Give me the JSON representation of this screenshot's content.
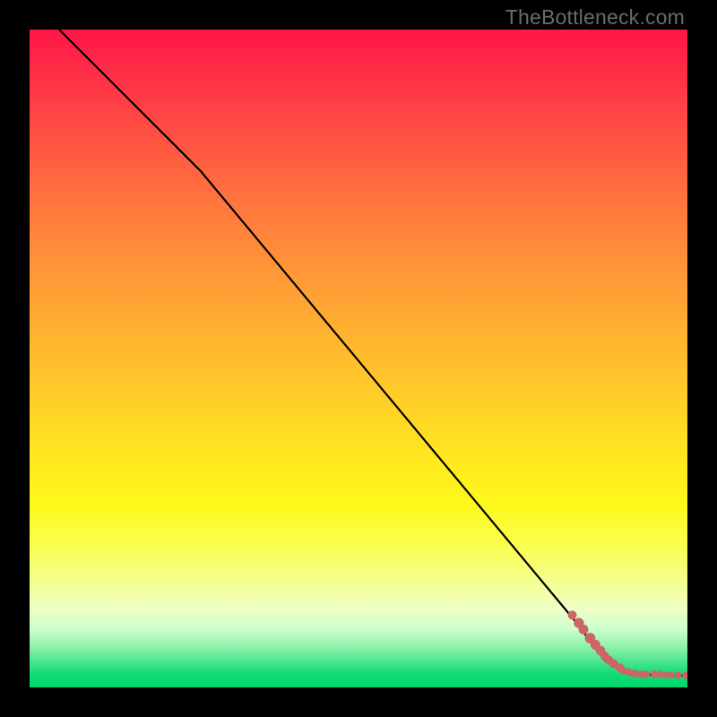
{
  "watermark": "TheBottleneck.com",
  "chart_data": {
    "type": "line",
    "title": "",
    "xlabel": "",
    "ylabel": "",
    "xlim": [
      0,
      100
    ],
    "ylim": [
      0,
      100
    ],
    "series": [
      {
        "name": "curve",
        "style": "line",
        "color": "#000000",
        "points": [
          {
            "x": 4.5,
            "y": 100.0
          },
          {
            "x": 26.0,
            "y": 78.5
          },
          {
            "x": 83.0,
            "y": 10.0
          },
          {
            "x": 87.5,
            "y": 4.0
          },
          {
            "x": 91.0,
            "y": 2.0
          },
          {
            "x": 100.0,
            "y": 1.8
          }
        ]
      },
      {
        "name": "dots",
        "style": "scatter",
        "color": "#cc6666",
        "points": [
          {
            "x": 82.5,
            "y": 11.0,
            "r": 4.5
          },
          {
            "x": 83.5,
            "y": 9.8,
            "r": 5.2
          },
          {
            "x": 84.2,
            "y": 8.8,
            "r": 5.0
          },
          {
            "x": 85.2,
            "y": 7.5,
            "r": 5.4
          },
          {
            "x": 86.0,
            "y": 6.5,
            "r": 5.0
          },
          {
            "x": 86.8,
            "y": 5.6,
            "r": 4.8
          },
          {
            "x": 87.4,
            "y": 4.8,
            "r": 4.5
          },
          {
            "x": 88.0,
            "y": 4.2,
            "r": 4.5
          },
          {
            "x": 88.8,
            "y": 3.6,
            "r": 4.5
          },
          {
            "x": 89.7,
            "y": 3.0,
            "r": 4.4
          },
          {
            "x": 90.2,
            "y": 2.6,
            "r": 3.8
          },
          {
            "x": 91.0,
            "y": 2.3,
            "r": 3.8
          },
          {
            "x": 92.0,
            "y": 2.1,
            "r": 3.8
          },
          {
            "x": 93.0,
            "y": 2.0,
            "r": 3.8
          },
          {
            "x": 93.8,
            "y": 2.0,
            "r": 3.4
          },
          {
            "x": 95.0,
            "y": 2.0,
            "r": 3.8
          },
          {
            "x": 95.8,
            "y": 2.0,
            "r": 3.4
          },
          {
            "x": 96.8,
            "y": 1.9,
            "r": 3.4
          },
          {
            "x": 97.6,
            "y": 1.9,
            "r": 3.0
          },
          {
            "x": 98.6,
            "y": 1.85,
            "r": 3.4
          },
          {
            "x": 99.8,
            "y": 1.8,
            "r": 3.8
          }
        ]
      }
    ]
  }
}
